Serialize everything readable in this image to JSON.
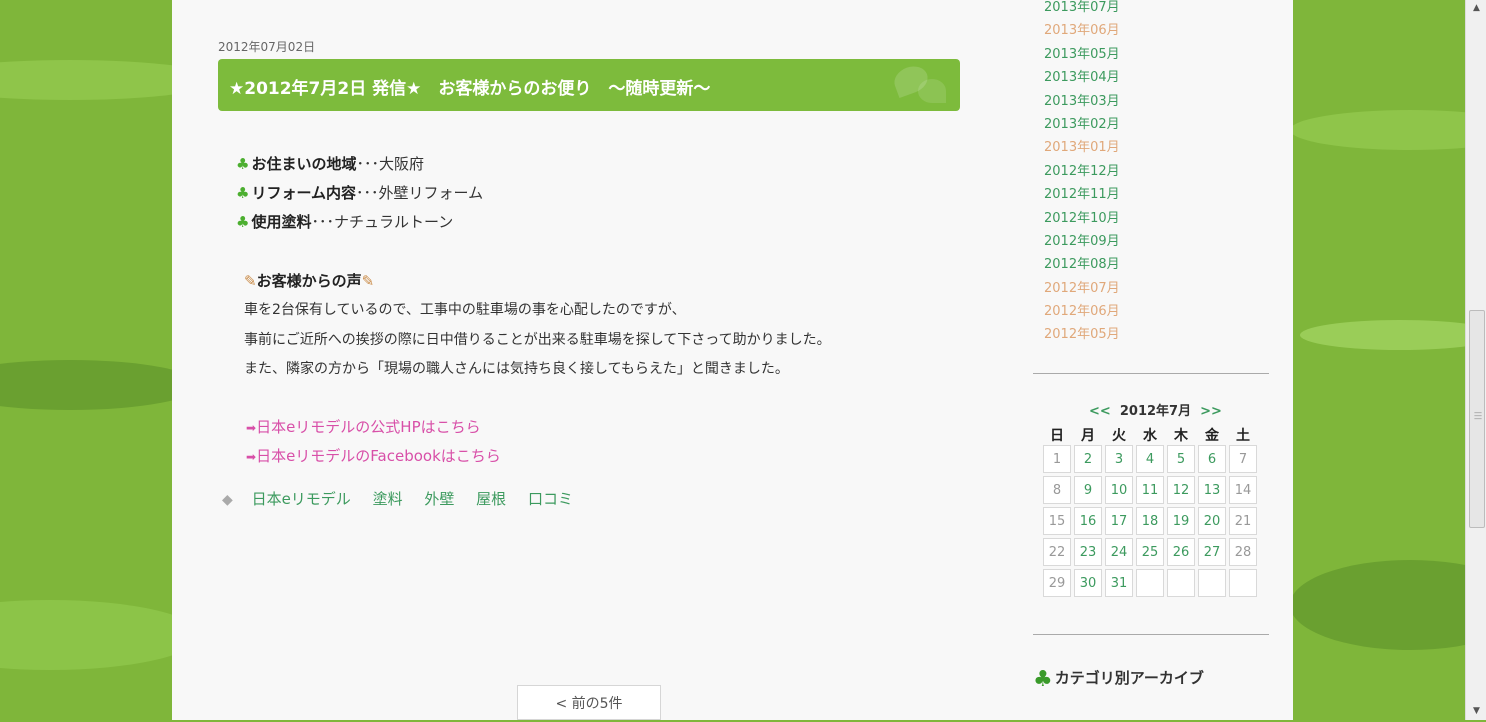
{
  "post": {
    "date": "2012年07月02日",
    "title": "★2012年7月2日 発信★　お客様からのお便り　～随時更新～",
    "info": [
      {
        "label": "お住まいの地域",
        "sep": "･･･",
        "value": "大阪府"
      },
      {
        "label": "リフォーム内容",
        "sep": "･･･",
        "value": "外壁リフォーム"
      },
      {
        "label": "使用塗料",
        "sep": "･･･",
        "value": "ナチュラルトーン"
      }
    ],
    "voice_heading": "お客様からの声",
    "voice_lines": [
      "車を2台保有しているので、工事中の駐車場の事を心配したのですが、",
      "事前にご近所への挨拶の際に日中借りることが出来る駐車場を探して下さって助かりました。",
      "また、隣家の方から「現場の職人さんには気持ち良く接してもらえた」と聞きました。"
    ],
    "links": [
      "日本eリモデルの公式HPはこちら",
      "日本eリモデルのFacebookはこちら"
    ],
    "tags": [
      "日本eリモデル",
      "塗料",
      "外壁",
      "屋根",
      "口コミ"
    ]
  },
  "pagination": {
    "prev_label": "< 前の5件"
  },
  "sidebar": {
    "months": [
      {
        "label": "2013年07月",
        "visited": false
      },
      {
        "label": "2013年06月",
        "visited": true
      },
      {
        "label": "2013年05月",
        "visited": false
      },
      {
        "label": "2013年04月",
        "visited": false
      },
      {
        "label": "2013年03月",
        "visited": false
      },
      {
        "label": "2013年02月",
        "visited": false
      },
      {
        "label": "2013年01月",
        "visited": true
      },
      {
        "label": "2012年12月",
        "visited": false
      },
      {
        "label": "2012年11月",
        "visited": false
      },
      {
        "label": "2012年10月",
        "visited": false
      },
      {
        "label": "2012年09月",
        "visited": false
      },
      {
        "label": "2012年08月",
        "visited": false
      },
      {
        "label": "2012年07月",
        "visited": true
      },
      {
        "label": "2012年06月",
        "visited": true
      },
      {
        "label": "2012年05月",
        "visited": true
      }
    ],
    "calendar": {
      "prev": "<<",
      "title": "2012年7月",
      "next": ">>",
      "weekdays": [
        "日",
        "月",
        "火",
        "水",
        "木",
        "金",
        "土"
      ],
      "weeks": [
        [
          "1",
          "2",
          "3",
          "4",
          "5",
          "6",
          "7"
        ],
        [
          "8",
          "9",
          "10",
          "11",
          "12",
          "13",
          "14"
        ],
        [
          "15",
          "16",
          "17",
          "18",
          "19",
          "20",
          "21"
        ],
        [
          "22",
          "23",
          "24",
          "25",
          "26",
          "27",
          "28"
        ],
        [
          "29",
          "30",
          "31",
          "",
          "",
          "",
          ""
        ]
      ],
      "linked_days": [
        "2",
        "3",
        "4",
        "5",
        "6",
        "9",
        "10",
        "11",
        "12",
        "13",
        "16",
        "17",
        "18",
        "19",
        "20",
        "23",
        "24",
        "25",
        "26",
        "27",
        "30",
        "31"
      ]
    },
    "category_heading": "カテゴリ別アーカイブ"
  },
  "colors": {
    "title_bg": "#7dbb3c",
    "link_green": "#3c9a5e",
    "visited": "#e0a87a",
    "pink_link": "#d84fa8"
  }
}
